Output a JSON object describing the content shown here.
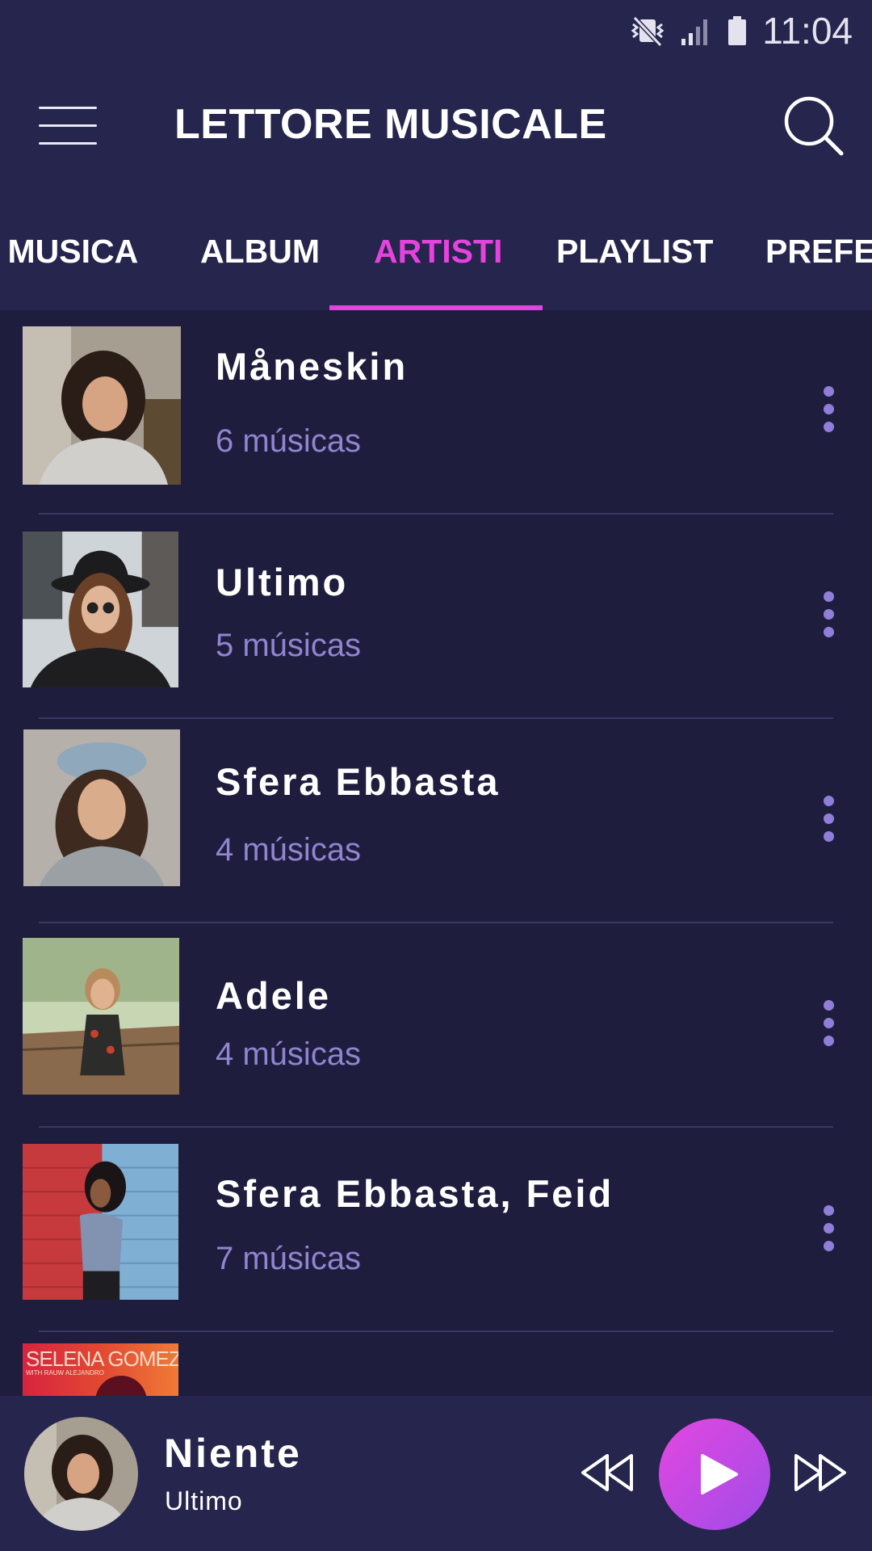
{
  "status_bar": {
    "time": "11:04"
  },
  "header": {
    "title": "LETTORE MUSICALE"
  },
  "tabs": [
    {
      "label": "A MUSICA"
    },
    {
      "label": "ALBUM"
    },
    {
      "label": "ARTISTI"
    },
    {
      "label": "PLAYLIST"
    },
    {
      "label": "PREFERITI"
    }
  ],
  "active_tab": "ARTISTI",
  "artists": [
    {
      "name": "Måneskin",
      "count": "6 músicas"
    },
    {
      "name": "Ultimo",
      "count": "5 músicas"
    },
    {
      "name": "Sfera Ebbasta",
      "count": "4 músicas"
    },
    {
      "name": "Adele",
      "count": "4 músicas"
    },
    {
      "name": "Sfera Ebbasta, Feid",
      "count": "7 músicas"
    }
  ],
  "partial_cover_text": {
    "line1": "SELENA GOMEZ",
    "line2": "WITH RAUW ALEJANDRO"
  },
  "now_playing": {
    "title": "Niente",
    "artist": "Ultimo"
  },
  "colors": {
    "accent": "#e443de",
    "background": "#1f1d3e",
    "header": "#26254d",
    "muted_text": "#8f85d0"
  }
}
